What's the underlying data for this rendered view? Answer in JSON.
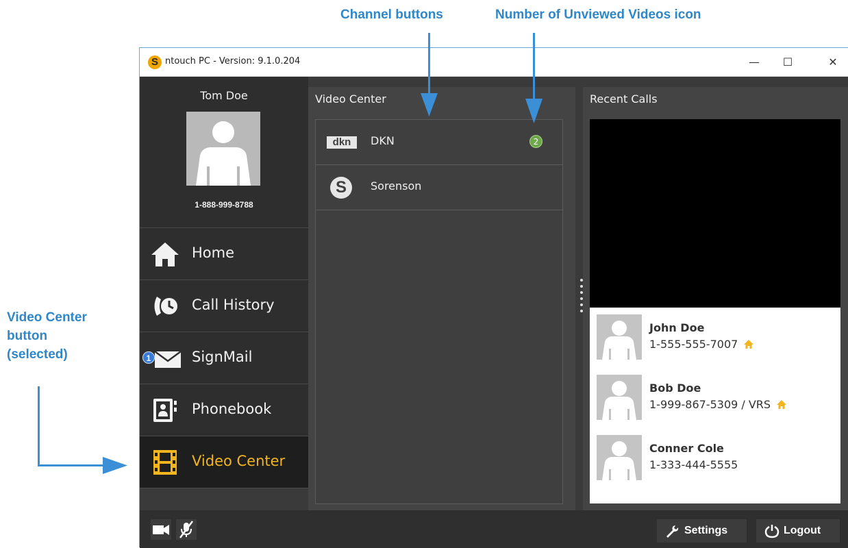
{
  "annotations": {
    "channel_buttons": "Channel buttons",
    "unviewed_icon": "Number of Unviewed Videos icon",
    "video_center_button_line1": "Video Center",
    "video_center_button_line2": "button",
    "video_center_button_line3": "(selected)"
  },
  "window": {
    "title": "ntouch PC  -  Version:  9.1.0.204",
    "app_logo_letter": "S"
  },
  "profile": {
    "name": "Tom Doe",
    "phone": "1-888-999-8788"
  },
  "nav": {
    "home": "Home",
    "call_history": "Call History",
    "signmail": "SignMail",
    "signmail_badge": "1",
    "phonebook": "Phonebook",
    "video_center": "Video Center"
  },
  "video_center": {
    "title": "Video Center",
    "channels": [
      {
        "label": "DKN",
        "logo_text": "dkn",
        "unviewed": "2"
      },
      {
        "label": "Sorenson",
        "logo_text": "S"
      }
    ]
  },
  "recent_calls": {
    "title": "Recent Calls",
    "calls": [
      {
        "name": "John Doe",
        "phone": "1-555-555-7007",
        "home": true
      },
      {
        "name": "Bob Doe",
        "phone": "1-999-867-5309 / VRS",
        "home": true
      },
      {
        "name": "Conner Cole",
        "phone": "1-333-444-5555",
        "home": false
      }
    ]
  },
  "bottom": {
    "settings": "Settings",
    "logout": "Logout"
  },
  "colors": {
    "accent": "#f2b51e",
    "annotation": "#2f87c8",
    "badge_green": "#6ea84a",
    "badge_blue": "#3a7bd5"
  }
}
